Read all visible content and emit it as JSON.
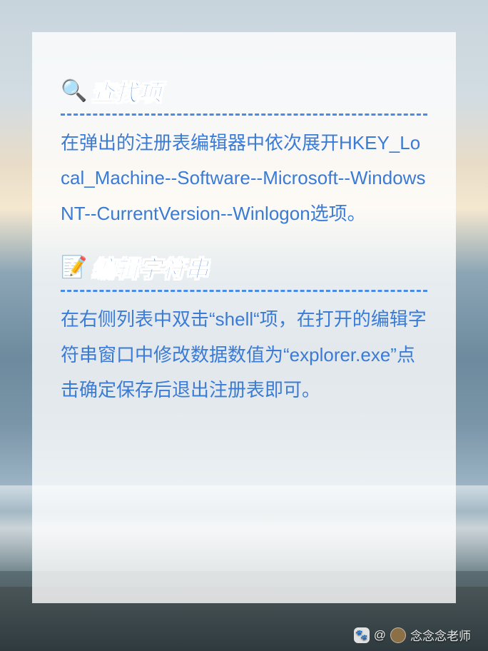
{
  "sections": [
    {
      "icon": "🔍",
      "heading": "查找项",
      "body": "在弹出的注册表编辑器中依次展开HKEY_Local_Machine--Software--Microsoft--Windows NT--CurrentVersion--Winlogon选项。"
    },
    {
      "icon": "📝",
      "heading": "编辑字符串",
      "body": "在右侧列表中双击“shell“项，在打开的编辑字符串窗口中修改数据数值为“explorer.exe”点击确定保存后退出注册表即可。"
    }
  ],
  "watermark": {
    "at": "@",
    "name": "念念念老师"
  }
}
